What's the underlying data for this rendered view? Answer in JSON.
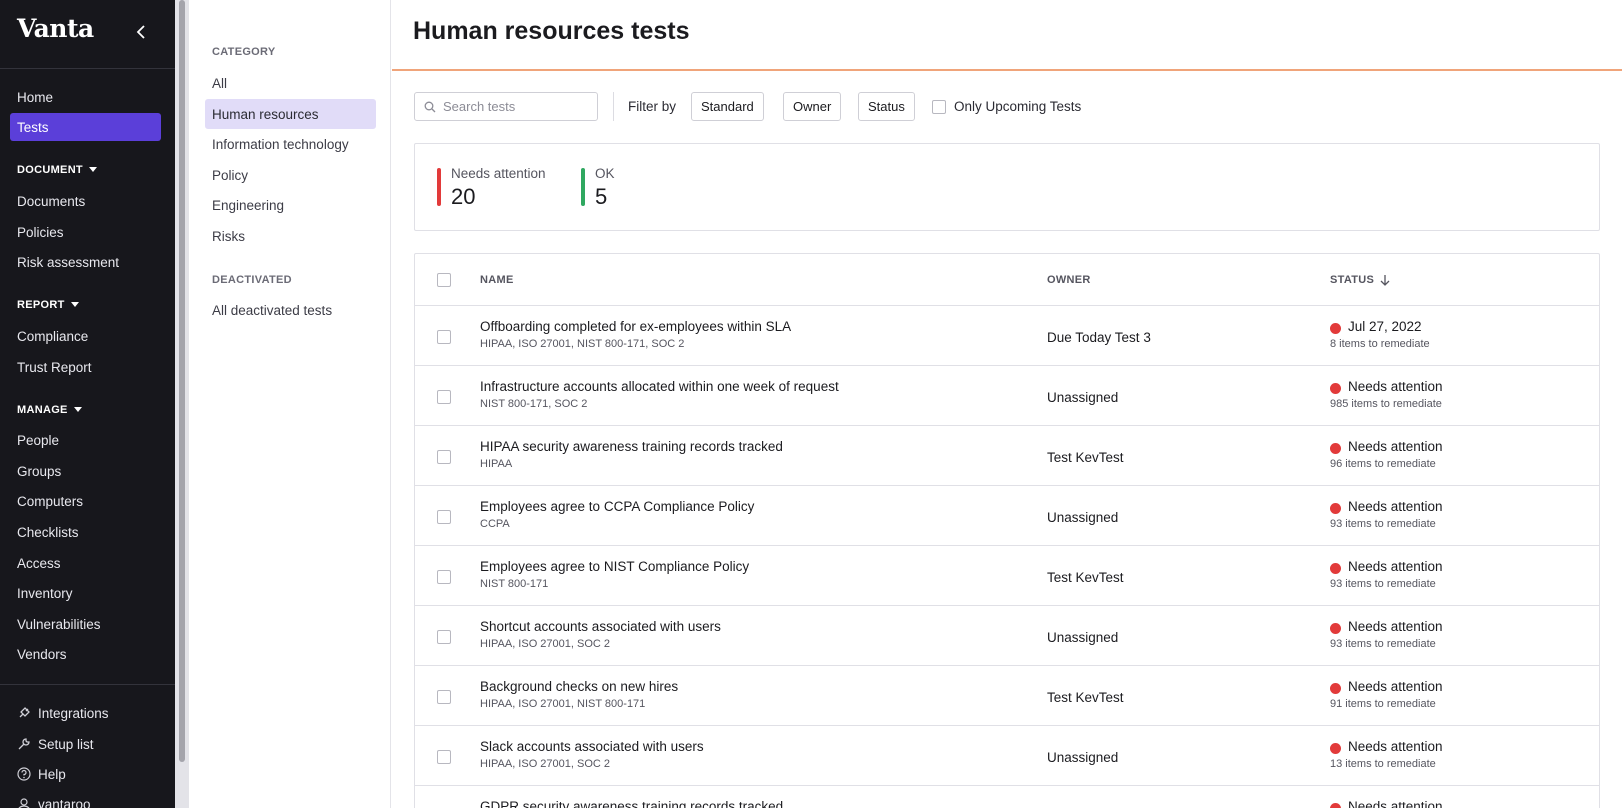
{
  "nav": {
    "logo": "Vanta",
    "items_top": [
      {
        "label": "Home",
        "active": false
      },
      {
        "label": "Tests",
        "active": true
      }
    ],
    "sections": [
      {
        "title": "DOCUMENT",
        "items": [
          "Documents",
          "Policies",
          "Risk assessment"
        ]
      },
      {
        "title": "REPORT",
        "items": [
          "Compliance",
          "Trust Report"
        ]
      },
      {
        "title": "MANAGE",
        "items": [
          "People",
          "Groups",
          "Computers",
          "Checklists",
          "Access",
          "Inventory",
          "Vulnerabilities",
          "Vendors"
        ]
      }
    ],
    "bottom": [
      {
        "label": "Integrations",
        "icon": "plug-icon"
      },
      {
        "label": "Setup list",
        "icon": "wrench-icon"
      },
      {
        "label": "Help",
        "icon": "help-circle-icon"
      },
      {
        "label": "vantaroo",
        "icon": "user-icon"
      }
    ]
  },
  "categories": {
    "heading": "CATEGORY",
    "items": [
      "All",
      "Human resources",
      "Information technology",
      "Policy",
      "Engineering",
      "Risks"
    ],
    "active": "Human resources",
    "deactivated_heading": "DEACTIVATED",
    "deactivated_item": "All deactivated tests"
  },
  "page": {
    "title": "Human resources tests"
  },
  "toolbar": {
    "search_placeholder": "Search tests",
    "filter_label": "Filter by",
    "filters": [
      "Standard",
      "Owner",
      "Status"
    ],
    "upcoming_label": "Only Upcoming Tests"
  },
  "summary": {
    "needs_attention_label": "Needs attention",
    "needs_attention_value": "20",
    "ok_label": "OK",
    "ok_value": "5",
    "colors": {
      "needs_attention": "#e23a3a",
      "ok": "#2fa860"
    }
  },
  "table": {
    "columns": {
      "name": "NAME",
      "owner": "OWNER",
      "status": "STATUS"
    },
    "rows": [
      {
        "name": "Offboarding completed for ex-employees within SLA",
        "standards": "HIPAA, ISO 27001, NIST 800-171, SOC 2",
        "owner": "Due Today Test 3",
        "status": "Jul 27, 2022",
        "remediate": "8 items to remediate"
      },
      {
        "name": "Infrastructure accounts allocated within one week of request",
        "standards": "NIST 800-171, SOC 2",
        "owner": "Unassigned",
        "status": "Needs attention",
        "remediate": "985 items to remediate"
      },
      {
        "name": "HIPAA security awareness training records tracked",
        "standards": "HIPAA",
        "owner": "Test KevTest",
        "status": "Needs attention",
        "remediate": "96 items to remediate"
      },
      {
        "name": "Employees agree to CCPA Compliance Policy",
        "standards": "CCPA",
        "owner": "Unassigned",
        "status": "Needs attention",
        "remediate": "93 items to remediate"
      },
      {
        "name": "Employees agree to NIST Compliance Policy",
        "standards": "NIST 800-171",
        "owner": "Test KevTest",
        "status": "Needs attention",
        "remediate": "93 items to remediate"
      },
      {
        "name": "Shortcut accounts associated with users",
        "standards": "HIPAA, ISO 27001, SOC 2",
        "owner": "Unassigned",
        "status": "Needs attention",
        "remediate": "93 items to remediate"
      },
      {
        "name": "Background checks on new hires",
        "standards": "HIPAA, ISO 27001, NIST 800-171",
        "owner": "Test KevTest",
        "status": "Needs attention",
        "remediate": "91 items to remediate"
      },
      {
        "name": "Slack accounts associated with users",
        "standards": "HIPAA, ISO 27001, SOC 2",
        "owner": "Unassigned",
        "status": "Needs attention",
        "remediate": "13 items to remediate"
      },
      {
        "name": "GDPR security awareness training records tracked",
        "standards": "",
        "owner": "",
        "status": "Needs attention",
        "remediate": ""
      }
    ]
  }
}
